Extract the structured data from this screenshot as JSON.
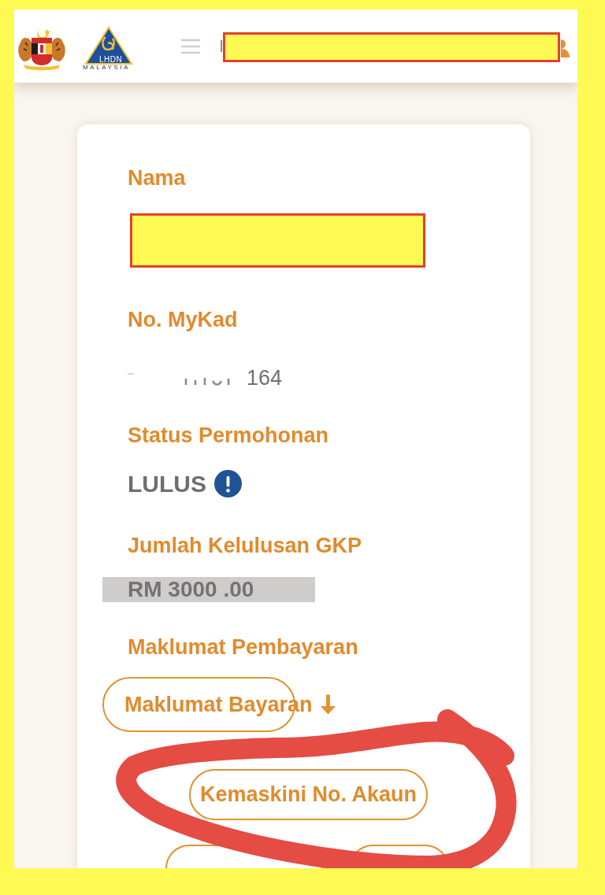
{
  "header": {
    "logo_text": "LHDN",
    "logo_caption": "MALAYSIA",
    "title_fragment": "I",
    "title_redacted": true
  },
  "fields": [
    {
      "label": "Nama",
      "kind": "redacted"
    },
    {
      "label": "No. MyKad",
      "kind": "partial",
      "value": "164"
    },
    {
      "label": "Status Permohonan",
      "kind": "status",
      "value": "LULUS",
      "info": true
    },
    {
      "label": "Jumlah Kelulusan GKP",
      "kind": "amount",
      "value": "RM 3000 .00"
    },
    {
      "label": "Maklumat Pembayaran",
      "kind": "download",
      "value": "Maklumat Bayaran"
    }
  ],
  "actions": [
    {
      "label": "Kemaskini No. Akaun",
      "circled": true
    }
  ]
}
